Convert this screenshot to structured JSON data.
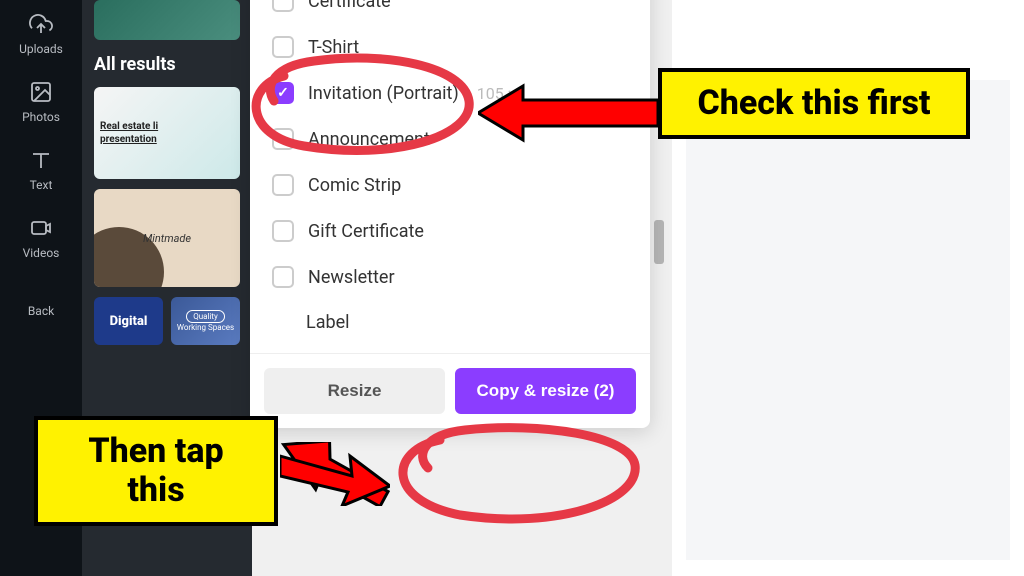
{
  "sidebar": {
    "items": [
      {
        "label": "Uploads",
        "icon": "upload"
      },
      {
        "label": "Photos",
        "icon": "photo"
      },
      {
        "label": "Text",
        "icon": "text"
      },
      {
        "label": "Videos",
        "icon": "video"
      },
      {
        "label": "Back",
        "icon": "back"
      }
    ]
  },
  "panel": {
    "section_header": "All results",
    "thumb2_line1": "Real estate li",
    "thumb2_line2": "presentation",
    "thumb3_text": "Mintmade",
    "thumb4_text": "Digital",
    "thumb5_badge": "Quality",
    "thumb5_text": "Working Spaces"
  },
  "dropdown": {
    "options": [
      {
        "label": "Certificate",
        "checked": false
      },
      {
        "label": "T-Shirt",
        "checked": false
      },
      {
        "label": "Invitation (Portrait)",
        "checked": true,
        "dimensions": "105 ×"
      },
      {
        "label": "Announcement",
        "checked": false
      },
      {
        "label": "Comic Strip",
        "checked": false
      },
      {
        "label": "Gift Certificate",
        "checked": false
      },
      {
        "label": "Newsletter",
        "checked": false
      },
      {
        "label": "Label",
        "checked": false
      }
    ],
    "footer": {
      "resize_label": "Resize",
      "copy_label": "Copy & resize (2)"
    }
  },
  "annotations": {
    "check_first": "Check this first",
    "then_tap": "Then tap this"
  },
  "colors": {
    "primary": "#8b3dff",
    "highlight": "#fff200",
    "arrow": "#ff0000",
    "circle": "#e63946"
  }
}
